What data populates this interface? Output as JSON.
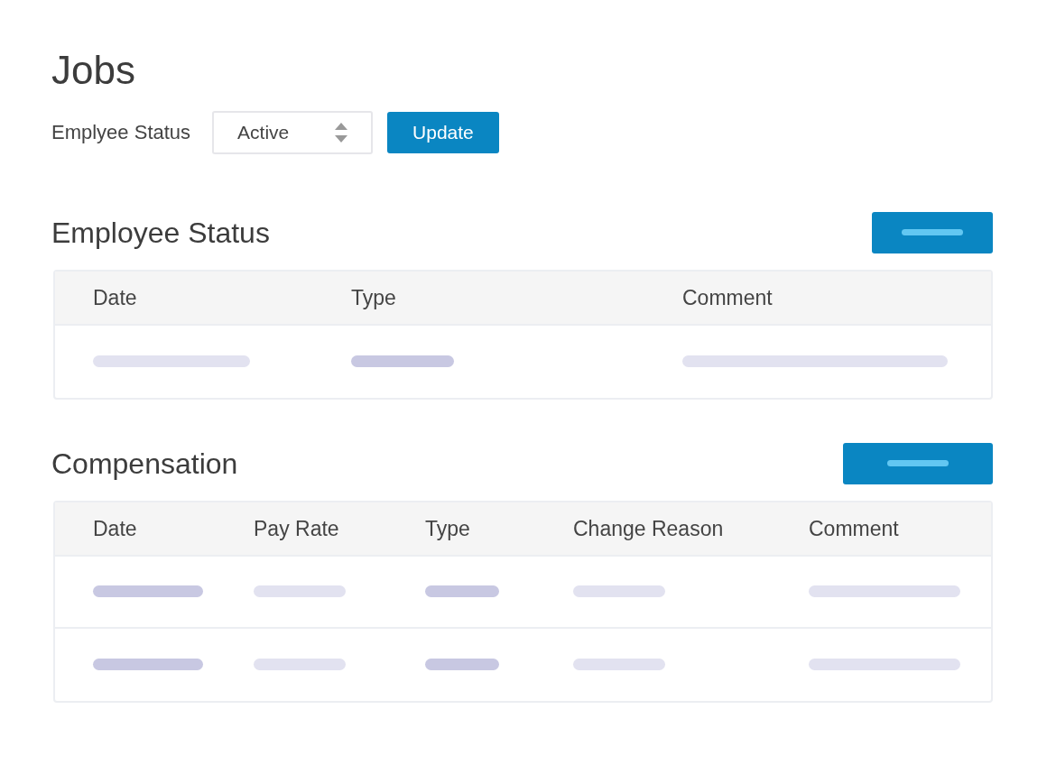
{
  "title": "Jobs",
  "filter": {
    "label": "Emplyee Status",
    "value": "Active",
    "button": "Update"
  },
  "sections": [
    {
      "title": "Employee Status",
      "columns": [
        "Date",
        "Type",
        "Comment"
      ],
      "rows": [
        {
          "cells": [
            {
              "color": "#e2e2f0"
            },
            {
              "color": "#c8c8e2"
            },
            {
              "color": "#e2e2f0"
            }
          ]
        }
      ]
    },
    {
      "title": "Compensation",
      "columns": [
        "Date",
        "Pay Rate",
        "Type",
        "Change Reason",
        "Comment"
      ],
      "rows": [
        {
          "cells": [
            {
              "color": "#c8c8e2"
            },
            {
              "color": "#e2e2f0"
            },
            {
              "color": "#c8c8e2"
            },
            {
              "color": "#e2e2f0"
            },
            {
              "color": "#e2e2f0"
            }
          ]
        },
        {
          "cells": [
            {
              "color": "#c8c8e2"
            },
            {
              "color": "#e2e2f0"
            },
            {
              "color": "#c8c8e2"
            },
            {
              "color": "#e2e2f0"
            },
            {
              "color": "#e2e2f0"
            }
          ]
        }
      ]
    }
  ]
}
